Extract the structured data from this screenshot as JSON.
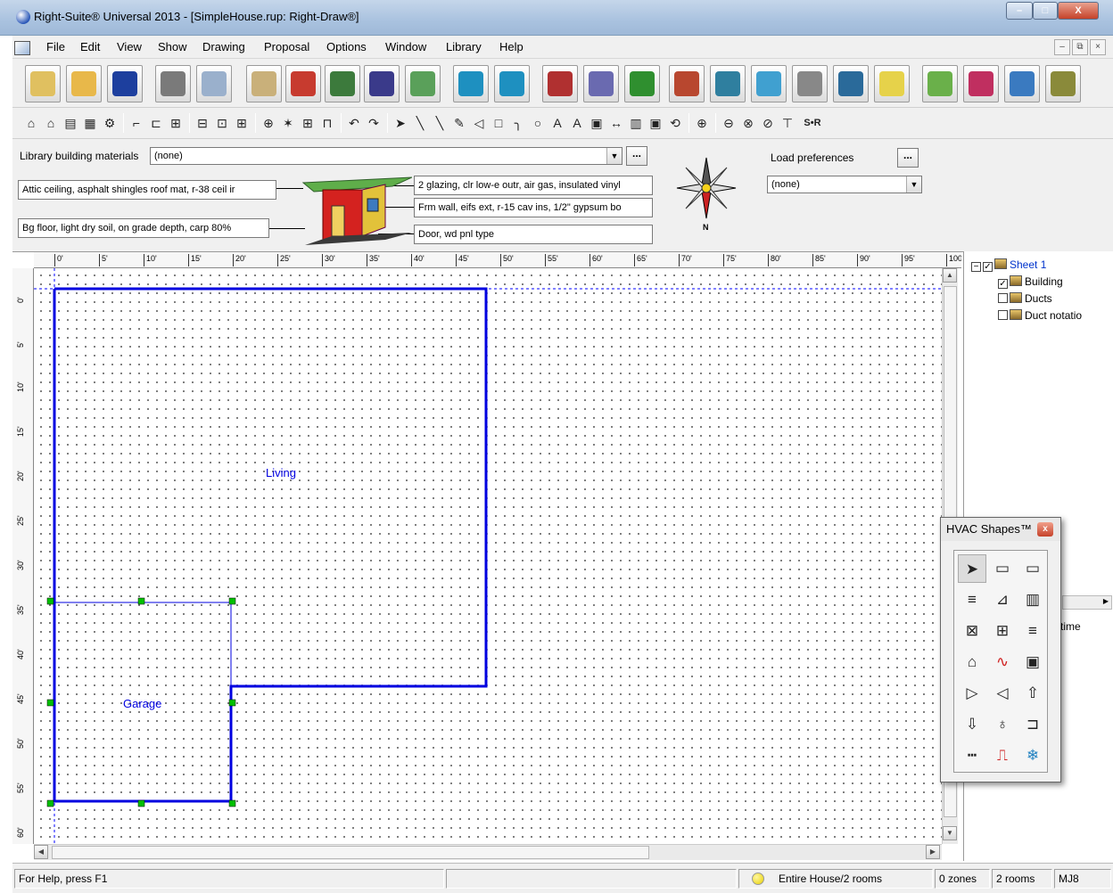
{
  "window": {
    "title": "Right-Suite® Universal 2013 - [SimpleHouse.rup: Right-Draw®]",
    "min": "–",
    "max": "□",
    "close": "X"
  },
  "menu": [
    "File",
    "Edit",
    "View",
    "Show",
    "Drawing",
    "Proposal",
    "Options",
    "Window",
    "Library",
    "Help"
  ],
  "mdi": {
    "min": "–",
    "restore": "⧉",
    "close": "×"
  },
  "toolbar1": [
    {
      "name": "new-icon",
      "color": "#e0c060"
    },
    {
      "name": "open-folder-icon",
      "color": "#e8b84a"
    },
    {
      "name": "save-icon",
      "color": "#1d3f9e"
    },
    {
      "name": "print-icon",
      "color": "#7a7a7a"
    },
    {
      "name": "print-preview-icon",
      "color": "#9ab0cc"
    },
    {
      "name": "script-icon",
      "color": "#c9b07a"
    },
    {
      "name": "house-window-icon",
      "color": "#c73b2f"
    },
    {
      "name": "house-search-icon",
      "color": "#3c7a3c"
    },
    {
      "name": "door-icon",
      "color": "#3a3a8a"
    },
    {
      "name": "drafting-icon",
      "color": "#5aa05a"
    },
    {
      "name": "zoom-in-icon",
      "color": "#1e90c0"
    },
    {
      "name": "zoom-out-icon",
      "color": "#1e90c0"
    },
    {
      "name": "house-red-icon",
      "color": "#b03030"
    },
    {
      "name": "gear-house-icon",
      "color": "#6a6ab0"
    },
    {
      "name": "dollar-icon",
      "color": "#2f8f2f"
    },
    {
      "name": "house-building-icon",
      "color": "#b8472f"
    },
    {
      "name": "roof-icon",
      "color": "#2f7f9f"
    },
    {
      "name": "snowflake-icon",
      "color": "#40a0d0"
    },
    {
      "name": "duct-icon",
      "color": "#888888"
    },
    {
      "name": "house-dollar-icon",
      "color": "#2a6a9a"
    },
    {
      "name": "graph-icon",
      "color": "#e6d24a"
    },
    {
      "name": "sheet-icon",
      "color": "#6ab04a"
    },
    {
      "name": "arrows-icon",
      "color": "#c02f60"
    },
    {
      "name": "pie-chart-icon",
      "color": "#3a7ac0"
    },
    {
      "name": "settings-gear-icon",
      "color": "#8a8a3a"
    }
  ],
  "toolbar2": [
    "⌂",
    "⌂",
    "▤",
    "▦",
    "⚙",
    "⌐",
    "⊏",
    "⊞",
    "⊟",
    "⊡",
    "⊞",
    "⊕",
    "✶",
    "⊞",
    "⊓",
    "↶",
    "↷",
    "➤",
    "╲",
    "╲",
    "✎",
    "◁",
    "□",
    "╮",
    "○",
    "A",
    "A",
    "▣",
    "↔",
    "▥",
    "▣",
    "⟲",
    "⊕",
    "⊖",
    "⊗",
    "⊘",
    "⊤",
    "S•R"
  ],
  "props": {
    "lib_label": "Library building materials",
    "lib_value": "(none)",
    "load_label": "Load preferences",
    "load_value": "(none)",
    "attic": "Attic ceiling, asphalt shingles roof mat, r-38 ceil ir",
    "floor": "Bg floor, light dry soil, on grade depth, carp 80%",
    "glazing": "2 glazing, clr low-e outr, air gas, insulated vinyl",
    "wall": "Frm wall, eifs ext, r-15 cav ins, 1/2\" gypsum bo",
    "door": "Door, wd pnl type",
    "dots": "...",
    "compass_n": "N"
  },
  "ruler": {
    "h": [
      "0'",
      "5'",
      "10'",
      "15'",
      "20'",
      "25'",
      "30'",
      "35'",
      "40'",
      "45'",
      "50'",
      "55'",
      "60'",
      "65'",
      "70'",
      "75'",
      "80'",
      "85'",
      "90'",
      "95'",
      "100'"
    ],
    "v": [
      "0'",
      "5'",
      "10'",
      "15'",
      "20'",
      "25'",
      "30'",
      "35'",
      "40'",
      "45'",
      "50'",
      "55'",
      "60'"
    ]
  },
  "rooms": {
    "living": "Living",
    "garage": "Garage"
  },
  "colors": {
    "wall": "#0000e0",
    "handle": "#00c000",
    "room_label": "#0000e0"
  },
  "tree": {
    "root": "Sheet 1",
    "items": [
      {
        "label": "Building",
        "checked": true
      },
      {
        "label": "Ducts",
        "checked": false
      },
      {
        "label": "Duct notatio",
        "checked": false
      }
    ],
    "extra": "time"
  },
  "hvac": {
    "title": "HVAC Shapes™",
    "close": "x",
    "tools": [
      [
        "➤",
        "▭",
        "▭"
      ],
      [
        "≡",
        "⊿",
        "▥"
      ],
      [
        "⊠",
        "⊞",
        "≡"
      ],
      [
        "⌂",
        "∿",
        "▣"
      ],
      [
        "▷",
        "◁",
        "⇧"
      ],
      [
        "⇩",
        "♁",
        "⊐"
      ],
      [
        "┅",
        "⎍",
        "❄"
      ]
    ]
  },
  "status": {
    "help": "For Help, press F1",
    "scope": "Entire House/2 rooms",
    "zones": "0 zones",
    "rooms": "2 rooms",
    "mode": "MJ8"
  }
}
